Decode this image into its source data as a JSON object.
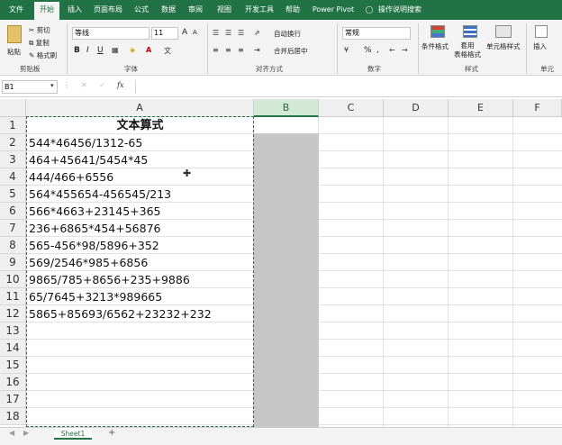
{
  "ribbon_tabs": [
    "文件",
    "开始",
    "插入",
    "页面布局",
    "公式",
    "数据",
    "审阅",
    "视图",
    "开发工具",
    "帮助",
    "Power Pivot",
    "操作说明搜索"
  ],
  "clipboard": {
    "paste": "粘贴",
    "cut": "剪切",
    "copy": "复制",
    "format_painter": "格式刷",
    "group": "剪贴板"
  },
  "font": {
    "name": "等线",
    "size": "11",
    "group": "字体",
    "bold": "B",
    "italic": "I",
    "underline": "U",
    "grow": "A",
    "shrink": "A"
  },
  "alignment": {
    "wrap": "自动换行",
    "merge": "合并后居中",
    "group": "对齐方式"
  },
  "number": {
    "format": "常规",
    "percent": "%",
    "comma": ",",
    "group": "数字"
  },
  "styles": {
    "conditional": "条件格式",
    "table": "套用\n表格格式",
    "cell_styles": "单元格样式",
    "group": "样式"
  },
  "cells": {
    "insert": "插入",
    "group": "单元"
  },
  "formula_bar": {
    "name_box": "B1",
    "fx": "fx",
    "content": ""
  },
  "columns": [
    "A",
    "B",
    "C",
    "D",
    "E",
    "F"
  ],
  "rows": [
    "1",
    "2",
    "3",
    "4",
    "5",
    "6",
    "7",
    "8",
    "9",
    "10",
    "11",
    "12",
    "13",
    "14",
    "15",
    "16",
    "17",
    "18"
  ],
  "cells_A": [
    "文本算式",
    "544*46456/1312-65",
    "464+45641/5454*45",
    "444/466+6556",
    "564*455654-456545/213",
    "566*4663+23145+365",
    "236+6865*454+56876",
    "565-456*98/5896+352",
    "569/2546*985+6856",
    "9865/785+8656+235+9886",
    "65/7645+3213*989665",
    "5865+85693/6562+23232+232"
  ],
  "sheet_tab": "Sheet1",
  "add_sheet": "+",
  "accent": "#217346"
}
